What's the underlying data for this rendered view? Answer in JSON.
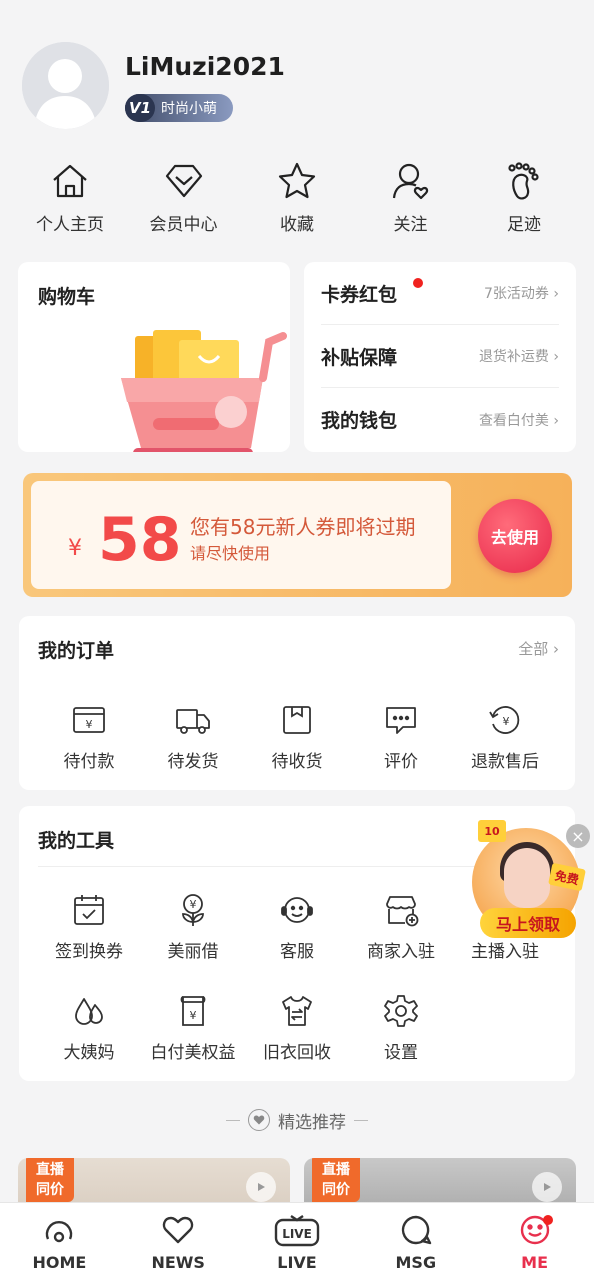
{
  "profile": {
    "username": "LiMuzi2021",
    "level_badge": "V1",
    "level_title": "时尚小萌"
  },
  "quicknav": [
    {
      "label": "个人主页",
      "icon": "home-icon"
    },
    {
      "label": "会员中心",
      "icon": "diamond-icon"
    },
    {
      "label": "收藏",
      "icon": "star-icon"
    },
    {
      "label": "关注",
      "icon": "follow-user-icon"
    },
    {
      "label": "足迹",
      "icon": "footprint-icon"
    }
  ],
  "cart": {
    "title": "购物车"
  },
  "links": [
    {
      "label": "卡券红包",
      "detail": "7张活动券"
    },
    {
      "label": "补贴保障",
      "detail": "退货补运费"
    },
    {
      "label": "我的钱包",
      "detail": "查看白付美"
    }
  ],
  "coupon": {
    "currency": "¥",
    "amount": "58",
    "message": "您有58元新人券即将过期",
    "sub_message": "请尽快使用",
    "button": "去使用"
  },
  "orders": {
    "title": "我的订单",
    "more": "全部",
    "items": [
      {
        "label": "待付款",
        "icon": "wallet-icon"
      },
      {
        "label": "待发货",
        "icon": "truck-icon"
      },
      {
        "label": "待收货",
        "icon": "package-icon"
      },
      {
        "label": "评价",
        "icon": "comment-icon"
      },
      {
        "label": "退款售后",
        "icon": "refund-icon"
      }
    ]
  },
  "tools": {
    "title": "我的工具",
    "row1": [
      {
        "label": "签到换券",
        "icon": "calendar-check-icon"
      },
      {
        "label": "美丽借",
        "icon": "loan-flower-icon"
      },
      {
        "label": "客服",
        "icon": "customer-service-icon"
      },
      {
        "label": "商家入驻",
        "icon": "shop-add-icon"
      },
      {
        "label": "主播入驻",
        "icon": "streamer-icon"
      }
    ],
    "row2": [
      {
        "label": "大姨妈",
        "icon": "drops-icon"
      },
      {
        "label": "白付美权益",
        "icon": "benefit-icon"
      },
      {
        "label": "旧衣回收",
        "icon": "shirt-recycle-icon"
      },
      {
        "label": "设置",
        "icon": "gear-icon"
      }
    ]
  },
  "promo": {
    "button": "马上领取",
    "tag1": "10",
    "tag2": "免费",
    "close": "×"
  },
  "recommend": {
    "label": "精选推荐"
  },
  "products": [
    {
      "badge_line1": "直播",
      "badge_line2": "同价"
    },
    {
      "badge_line1": "直播",
      "badge_line2": "同价"
    }
  ],
  "tabbar": [
    {
      "label": "HOME",
      "icon": "home-tab-icon"
    },
    {
      "label": "NEWS",
      "icon": "heart-tab-icon"
    },
    {
      "label": "LIVE",
      "icon": "live-tab-icon",
      "icon_text": "LIVE"
    },
    {
      "label": "MSG",
      "icon": "message-tab-icon"
    },
    {
      "label": "ME",
      "icon": "me-tab-icon",
      "active": true
    }
  ],
  "colors": {
    "accent": "#e8304d",
    "coupon_orange": "#f6b15a",
    "price_red": "#f24a49"
  }
}
